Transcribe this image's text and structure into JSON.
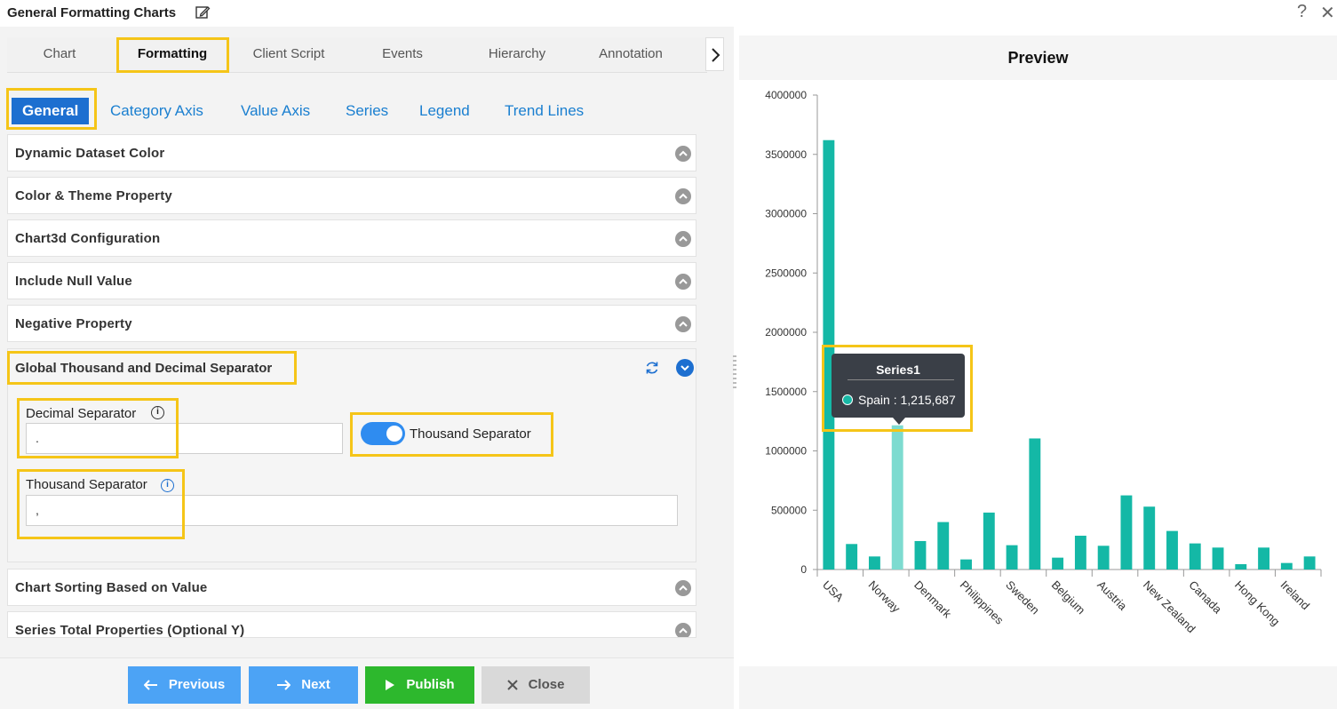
{
  "window": {
    "title": "General Formatting Charts",
    "help": "?",
    "close": "✕"
  },
  "main_tabs": [
    {
      "label": "Chart"
    },
    {
      "label": "Formatting",
      "active": true
    },
    {
      "label": "Client Script"
    },
    {
      "label": "Events"
    },
    {
      "label": "Hierarchy"
    },
    {
      "label": "Annotation"
    }
  ],
  "sub_tabs": [
    {
      "label": "General",
      "active": true
    },
    {
      "label": "Category Axis"
    },
    {
      "label": "Value Axis"
    },
    {
      "label": "Series"
    },
    {
      "label": "Legend"
    },
    {
      "label": "Trend Lines"
    }
  ],
  "sections_top": [
    {
      "label": "Dynamic Dataset Color"
    },
    {
      "label": "Color & Theme Property"
    },
    {
      "label": "Chart3d Configuration"
    },
    {
      "label": "Include Null Value"
    },
    {
      "label": "Negative Property"
    }
  ],
  "separator_section": {
    "title": "Global Thousand and Decimal Separator",
    "decimal_label": "Decimal Separator",
    "decimal_value": ".",
    "toggle_label": "Thousand Separator",
    "toggle_on": true,
    "thousand_label": "Thousand Separator",
    "thousand_value": ","
  },
  "sections_bottom": [
    {
      "label": "Chart Sorting Based on Value"
    },
    {
      "label": "Series Total Properties (Optional Y)"
    }
  ],
  "footer": {
    "previous": "Previous",
    "next": "Next",
    "publish": "Publish",
    "close": "Close"
  },
  "preview": {
    "title": "Preview",
    "tooltip": {
      "series": "Series1",
      "text": "Spain : 1,215,687"
    }
  },
  "colors": {
    "bar": "#14b8a6",
    "bar_hover": "#7ddbd0",
    "highlight": "#f5c518",
    "accent": "#1d6fd0"
  },
  "chart_data": {
    "type": "bar",
    "series": [
      {
        "name": "Series1",
        "values": [
          3620000,
          215000,
          110000,
          1215687,
          240000,
          400000,
          85000,
          480000,
          205000,
          1105000,
          100000,
          285000,
          200000,
          625000,
          530000,
          325000,
          220000,
          185000,
          45000,
          185000,
          55000,
          110000
        ]
      }
    ],
    "categories": [
      "USA",
      "",
      "Norway",
      "",
      "Denmark",
      "",
      "Philippines",
      "",
      "Sweden",
      "",
      "Belgium",
      "",
      "Austria",
      "",
      "New Zealand",
      "",
      "Canada",
      "",
      "Hong Kong",
      "",
      "Ireland",
      ""
    ],
    "highlighted_index": 3,
    "ylim": [
      0,
      4000000
    ],
    "yticks": [
      "0",
      "500000",
      "1000000",
      "1500000",
      "2000000",
      "2500000",
      "3000000",
      "3500000",
      "4000000"
    ],
    "legend": "none",
    "grid": false
  }
}
